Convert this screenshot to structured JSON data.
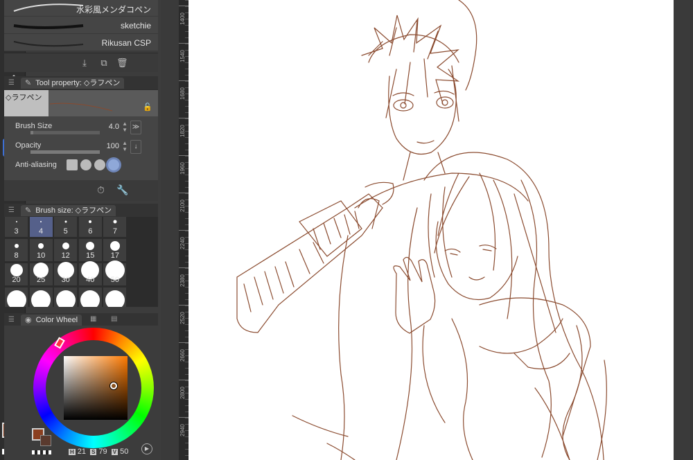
{
  "brush_list": {
    "items": [
      "水彩風メンダコペン",
      "sketchie",
      "Rikusan CSP"
    ]
  },
  "tool_property": {
    "title": "Tool property: ◇ラフペン",
    "preset_name": "◇ラフペン",
    "brush_size_label": "Brush Size",
    "brush_size_value": "4.0",
    "opacity_label": "Opacity",
    "opacity_value": "100",
    "antialiasing_label": "Anti-aliasing",
    "brush_size_fill": 0.04,
    "opacity_fill": 1.0
  },
  "brush_size_panel": {
    "title": "Brush size: ◇ラフペン",
    "sizes": [
      "3",
      "4",
      "5",
      "6",
      "7",
      "8",
      "10",
      "12",
      "15",
      "17",
      "20",
      "25",
      "30",
      "40",
      "50"
    ],
    "selected": "4"
  },
  "color_wheel": {
    "title": "Color Wheel",
    "h_label": "H",
    "h": "21",
    "s_label": "S",
    "s": "79",
    "v_label": "V",
    "v": "50",
    "main_color": "#8b3f1f",
    "sub_color": "#5a3a2e"
  },
  "ruler": {
    "labels": [
      "1400",
      "1540",
      "1680",
      "1820",
      "1960",
      "2100",
      "2240",
      "2380",
      "2520",
      "2660",
      "2800",
      "2940"
    ]
  },
  "toolbar": {
    "tools": [
      "move-icon",
      "lasso-icon",
      "magic-wand-icon",
      "eyedropper-icon",
      "pen-blend-icon",
      "pen-icon",
      "pencil-icon",
      "eraser-icon",
      "stamp-icon",
      "settings-icon",
      "blend-drops-icon",
      "fill-icon",
      "shape-icon",
      "gradient-icon",
      "curve-icon",
      "frame-icon",
      "text-icon",
      "balloon-icon",
      "pointer-icon"
    ],
    "active": "pencil-icon"
  },
  "colors": {
    "accent": "#3d6fd3",
    "sketch_line": "#8a4a2e"
  }
}
